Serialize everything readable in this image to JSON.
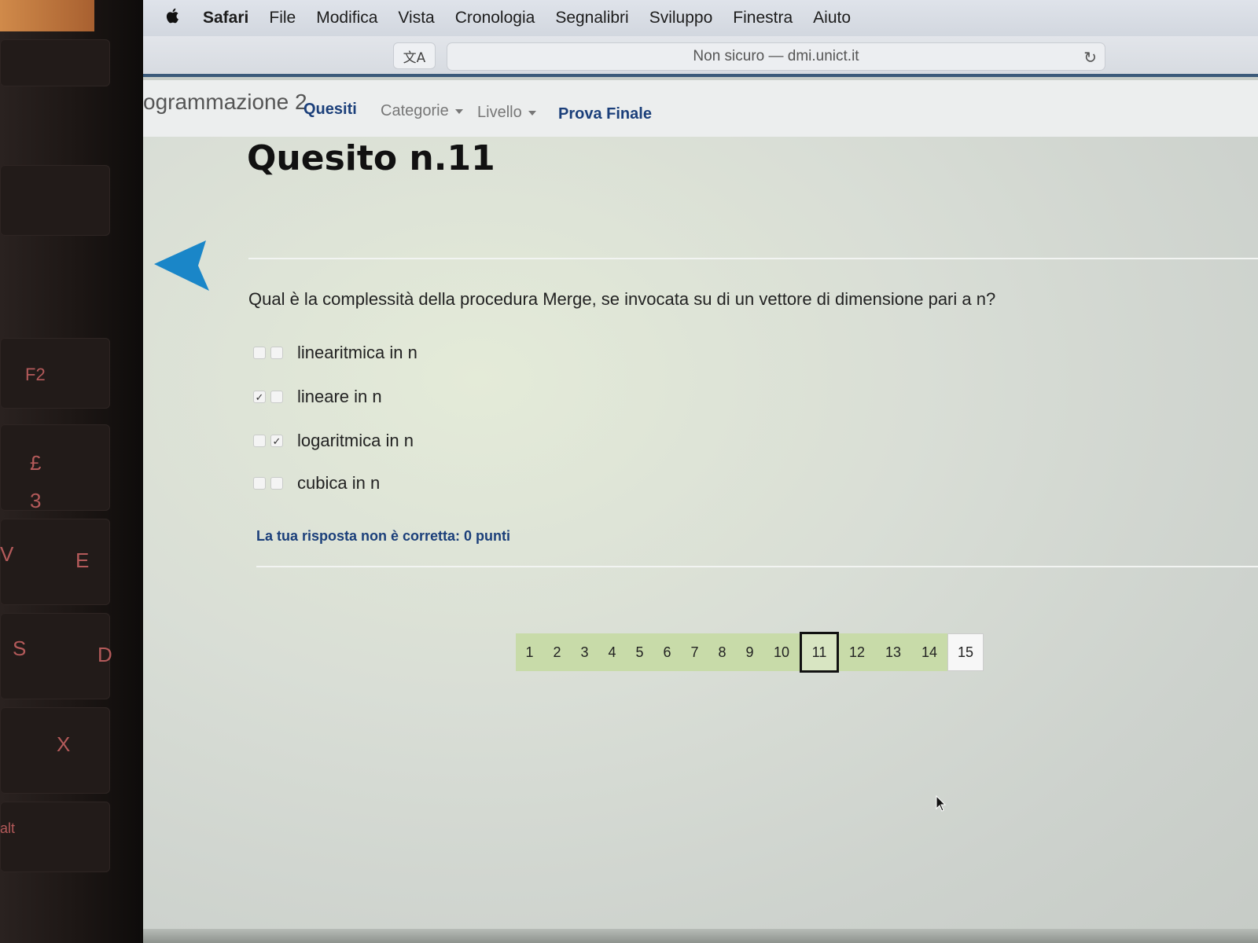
{
  "keyboard": {
    "keys": [
      "F2",
      "£",
      "3",
      "V",
      "E",
      "S",
      "D",
      "X",
      "alt"
    ]
  },
  "menubar": {
    "apple": "",
    "app_name": "Safari",
    "items": [
      "File",
      "Modifica",
      "Vista",
      "Cronologia",
      "Segnalibri",
      "Sviluppo",
      "Finestra",
      "Aiuto"
    ]
  },
  "toolbar": {
    "translate_icon": "文A",
    "address": "Non sicuro — dmi.unict.it",
    "reload_icon": "↻"
  },
  "navbar": {
    "brand": "ogrammazione 2",
    "quesiti": "Quesiti",
    "categorie": "Categorie",
    "livello": "Livello",
    "prova_finale": "Prova Finale"
  },
  "quiz": {
    "title": "Quesito n.11",
    "question": "Qual è la complessità della procedura Merge, se invocata su di un vettore di dimensione pari a n?",
    "options": [
      {
        "label": "linearitmica in n",
        "mark_a": "",
        "mark_b": ""
      },
      {
        "label": "lineare in n",
        "mark_a": "✓",
        "mark_b": ""
      },
      {
        "label": "logaritmica in n",
        "mark_a": "",
        "mark_b": "✓"
      },
      {
        "label": "cubica in n",
        "mark_a": "",
        "mark_b": ""
      }
    ],
    "feedback": "La tua risposta non è corretta: 0 punti"
  },
  "pagination": {
    "pages": [
      "1",
      "2",
      "3",
      "4",
      "5",
      "6",
      "7",
      "8",
      "9",
      "10",
      "11",
      "12",
      "13",
      "14",
      "15"
    ],
    "current": "11"
  },
  "colors": {
    "accent_blue": "#1b3f7a",
    "back_arrow": "#1a86c8",
    "page_green": "#c8dba9"
  }
}
